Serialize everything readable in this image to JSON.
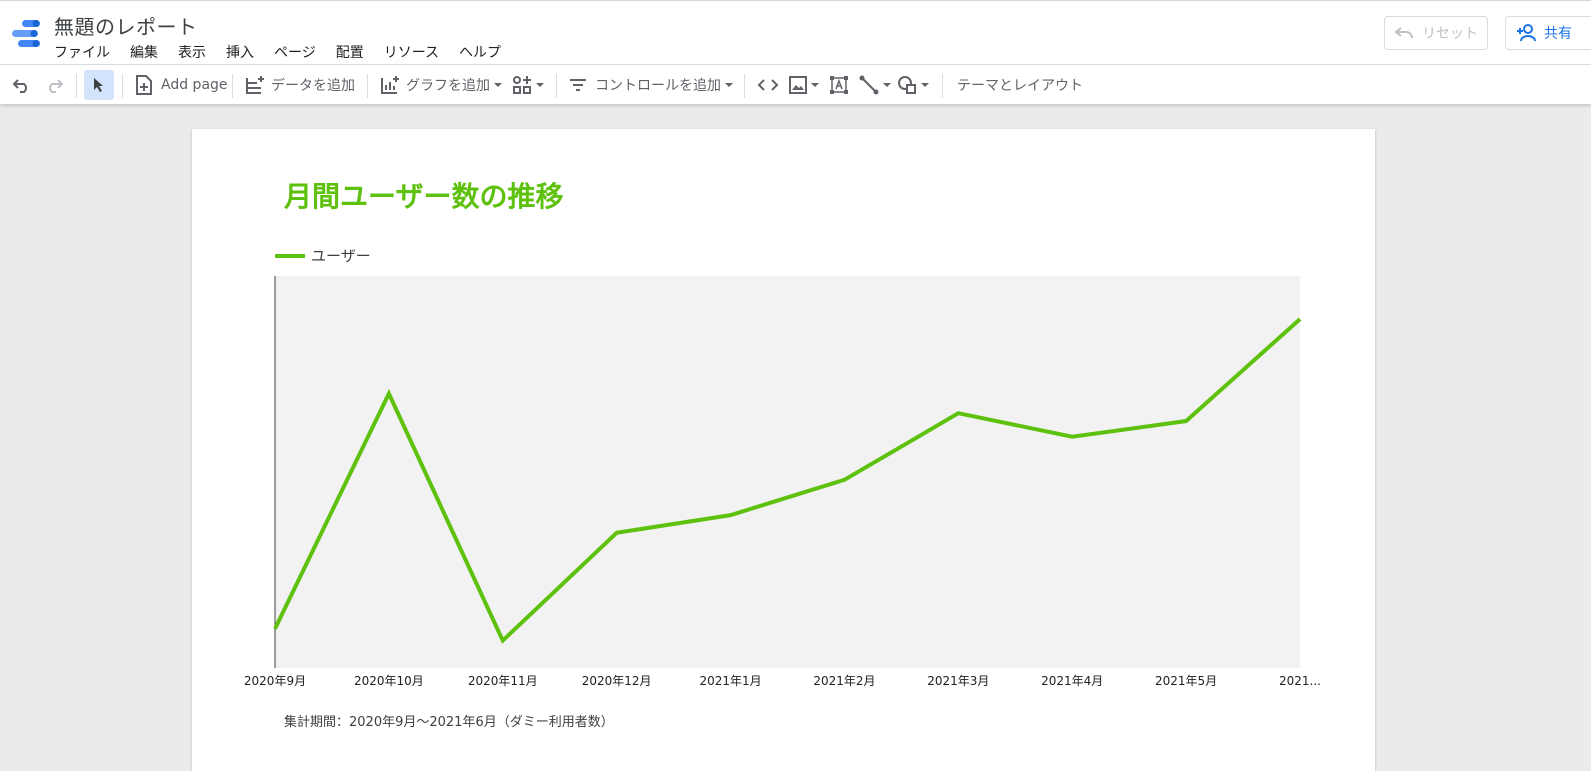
{
  "header": {
    "doc_title": "無題のレポート",
    "menu": [
      "ファイル",
      "編集",
      "表示",
      "挿入",
      "ページ",
      "配置",
      "リソース",
      "ヘルプ"
    ],
    "reset_label": "リセット",
    "share_label": "共有"
  },
  "toolbar": {
    "add_page_label": "Add page",
    "add_data_label": "データを追加",
    "add_chart_label": "グラフを追加",
    "add_control_label": "コントロールを追加",
    "theme_layout_label": "テーマとレイアウト"
  },
  "report": {
    "title": "月間ユーザー数の推移",
    "footnote": "集計期間：2020年9月～2021年6月（ダミー利用者数）"
  },
  "colors": {
    "accent": "#5ec10e",
    "plot_bg": "#f2f2f2",
    "link": "#1a73e8"
  },
  "chart_data": {
    "type": "line",
    "categories": [
      "2020年9月",
      "2020年10月",
      "2020年11月",
      "2020年12月",
      "2021年1月",
      "2021年2月",
      "2021年3月",
      "2021年4月",
      "2021年5月",
      "2021..."
    ],
    "series": [
      {
        "name": "ユーザー",
        "values": [
          100,
          700,
          70,
          345,
          390,
          480,
          650,
          590,
          630,
          890
        ]
      }
    ],
    "ylim": [
      0,
      1000
    ],
    "grid": false,
    "legend_position": "top-left"
  }
}
